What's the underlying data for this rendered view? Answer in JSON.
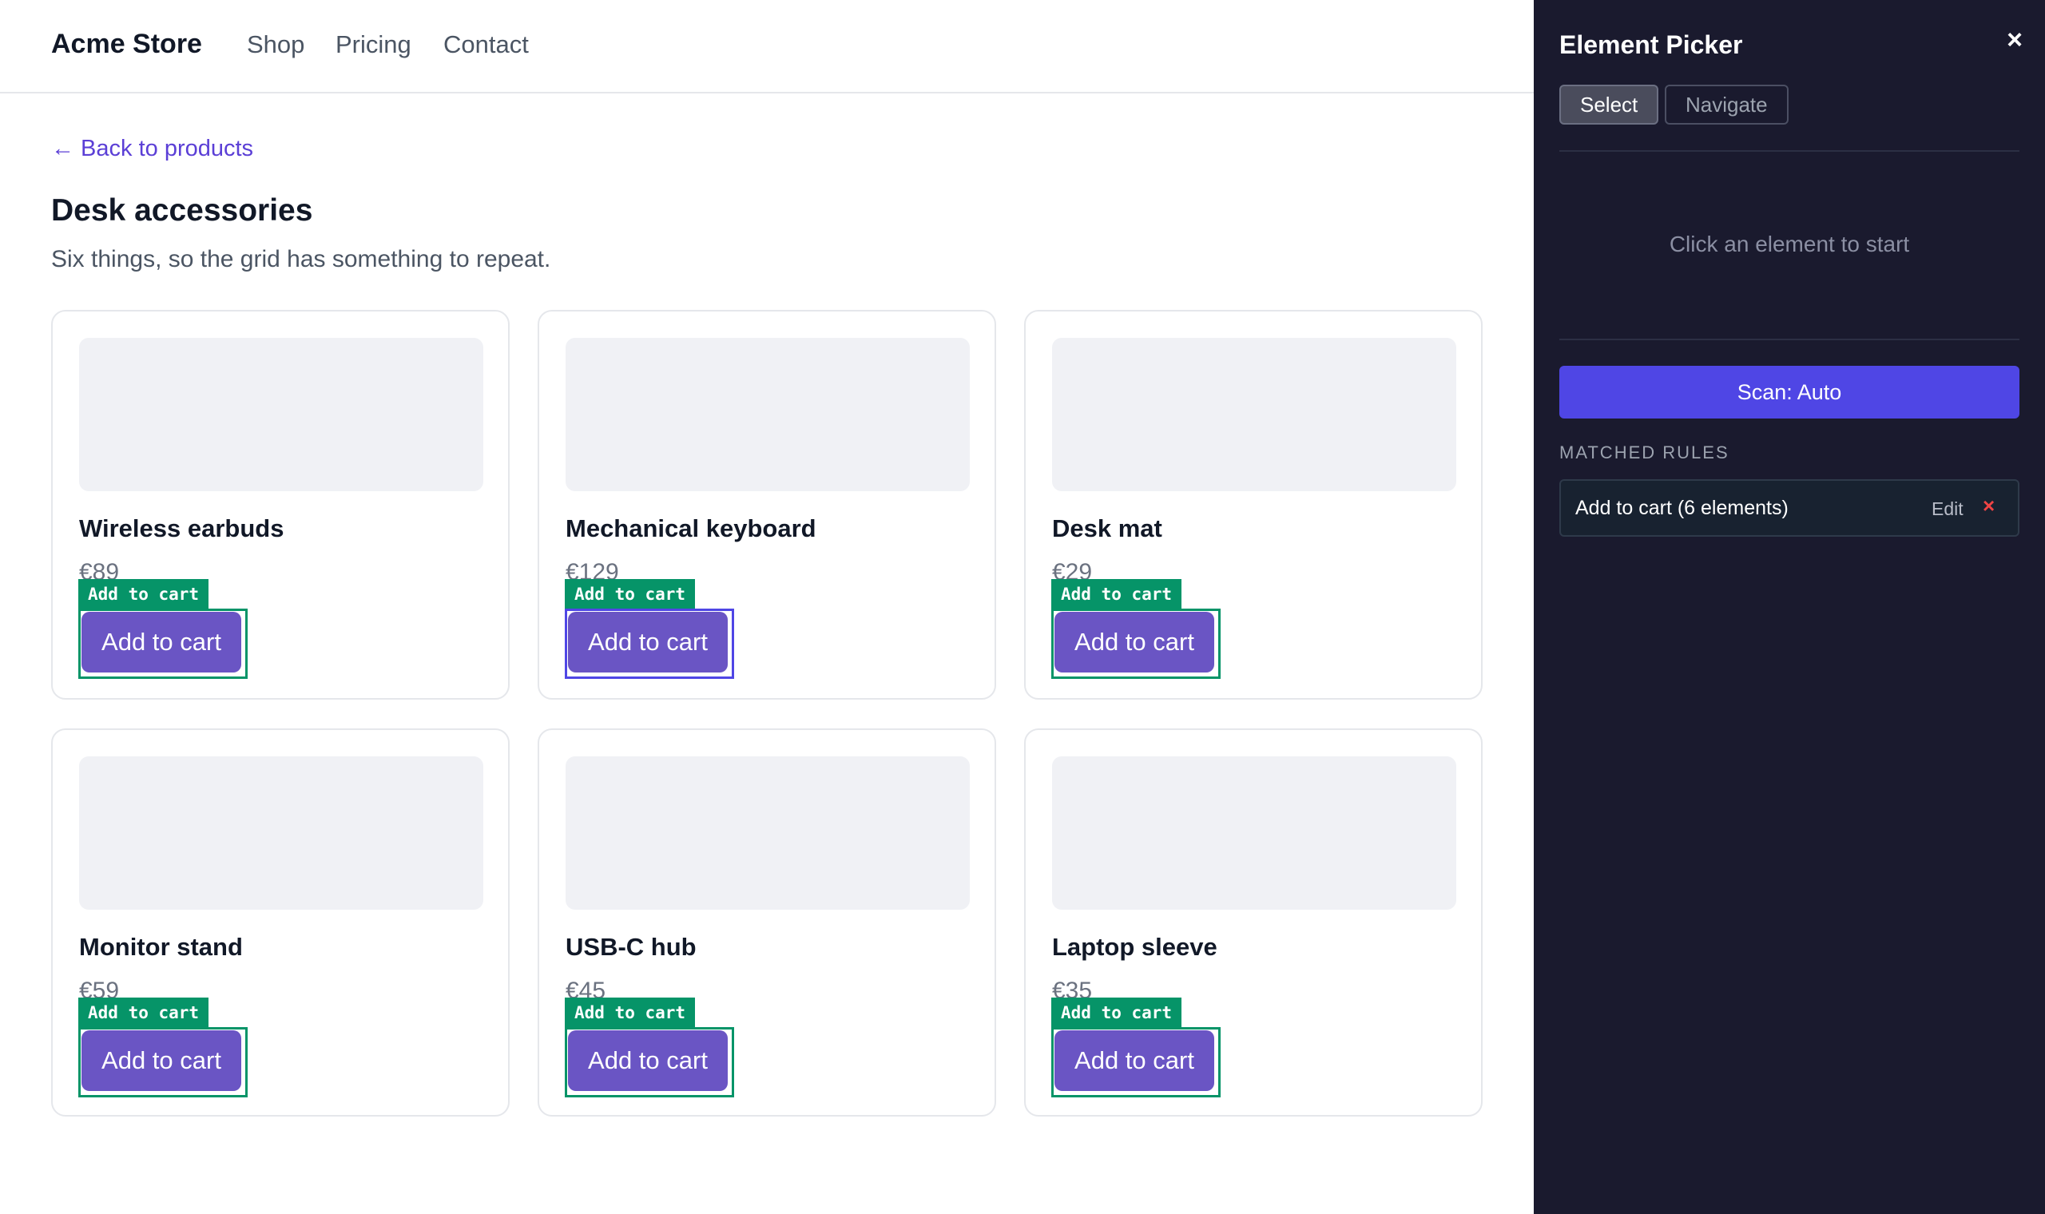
{
  "header": {
    "brand": "Acme Store",
    "nav": [
      "Shop",
      "Pricing",
      "Contact"
    ]
  },
  "page": {
    "back_link": "← Back to products",
    "title": "Desk accessories",
    "subtitle": "Six things, so the grid has something to repeat."
  },
  "products": [
    {
      "name": "Wireless earbuds",
      "price": "€89",
      "tag": "Add to cart",
      "button": "Add to cart"
    },
    {
      "name": "Mechanical keyboard",
      "price": "€129",
      "tag": "Add to cart",
      "button": "Add to cart"
    },
    {
      "name": "Desk mat",
      "price": "€29",
      "tag": "Add to cart",
      "button": "Add to cart"
    },
    {
      "name": "Monitor stand",
      "price": "€59",
      "tag": "Add to cart",
      "button": "Add to cart"
    },
    {
      "name": "USB-C hub",
      "price": "€45",
      "tag": "Add to cart",
      "button": "Add to cart"
    },
    {
      "name": "Laptop sleeve",
      "price": "€35",
      "tag": "Add to cart",
      "button": "Add to cart"
    }
  ],
  "panel": {
    "title": "Element Picker",
    "close": "×",
    "modes": [
      "Select",
      "Navigate"
    ],
    "active_mode": "Select",
    "empty_state": "Click an element to start",
    "scan_button": "Scan: Auto",
    "matched_rules_label": "MATCHED RULES",
    "rules": [
      {
        "label": "Add to cart (6 elements)",
        "edit": "Edit",
        "remove": "×"
      }
    ]
  },
  "colors": {
    "accent": "#4f46e5",
    "highlight": "#069468",
    "button": "#6a55c4",
    "panel_bg": "#1a1a2e"
  }
}
